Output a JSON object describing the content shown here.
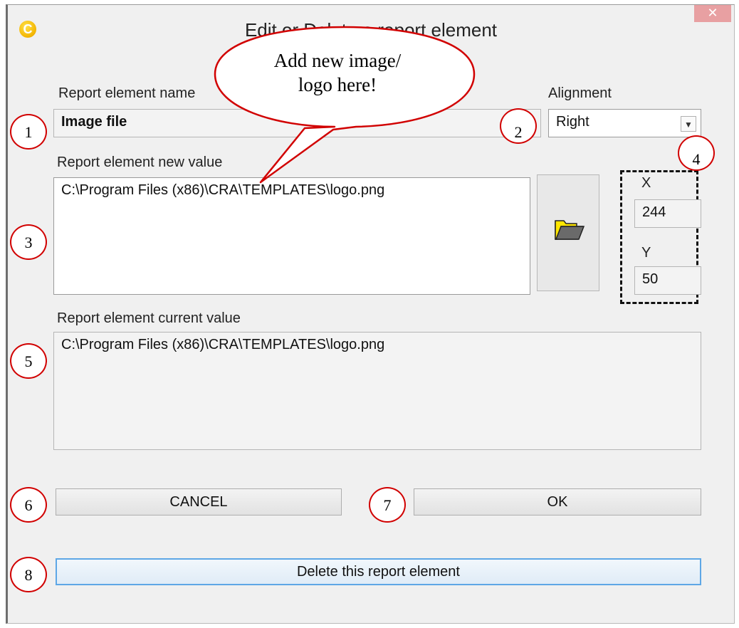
{
  "window": {
    "title": "Edit or Delete a report element",
    "app_icon_letter": "C",
    "close_label": "✕"
  },
  "form": {
    "name_label": "Report element name",
    "name_value": "Image file",
    "alignment_label": "Alignment",
    "alignment_value": "Right",
    "new_value_label": "Report element new value",
    "new_value": "C:\\Program Files (x86)\\CRA\\TEMPLATES\\logo.png",
    "x_label": "X",
    "x_value": "244",
    "y_label": "Y",
    "y_value": "50",
    "current_value_label": "Report element current value",
    "current_value": "C:\\Program Files (x86)\\CRA\\TEMPLATES\\logo.png"
  },
  "buttons": {
    "cancel": "CANCEL",
    "ok": "OK",
    "delete": "Delete this report element"
  },
  "annotation": {
    "callout_text_line1": "Add new image/",
    "callout_text_line2": "logo here!",
    "markers": [
      "1",
      "2",
      "3",
      "4",
      "5",
      "6",
      "7",
      "8"
    ]
  },
  "icons": [
    "app-icon",
    "close-icon",
    "chevron-down-icon",
    "folder-open-icon"
  ]
}
